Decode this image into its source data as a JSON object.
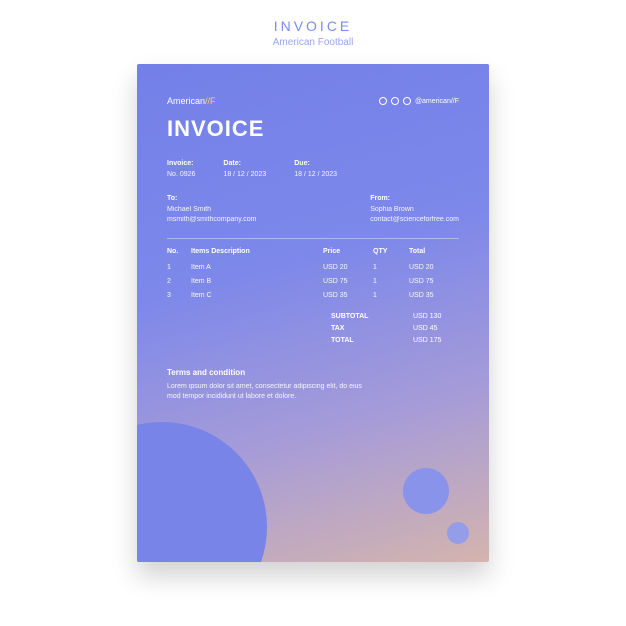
{
  "header": {
    "title": "INVOICE",
    "subtitle": "American Football"
  },
  "brand": {
    "name": "American",
    "accent": "//F"
  },
  "social": {
    "handle": "@american//F"
  },
  "bigTitle": "INVOICE",
  "meta": {
    "invoice": {
      "label": "Invoice:",
      "value": "No. 0926"
    },
    "date": {
      "label": "Date:",
      "value": "18 / 12 / 2023"
    },
    "due": {
      "label": "Due:",
      "value": "18 / 12 / 2023"
    }
  },
  "to": {
    "label": "To:",
    "name": "Michael Smith",
    "email": "msmith@smithcompany.com"
  },
  "from": {
    "label": "From:",
    "name": "Sophia Brown",
    "email": "contact@scienceforfree.com"
  },
  "columns": {
    "no": "No.",
    "desc": "Items Description",
    "price": "Price",
    "qty": "QTY",
    "total": "Total"
  },
  "items": [
    {
      "no": "1",
      "desc": "Item A",
      "price": "USD 20",
      "qty": "1",
      "total": "USD 20"
    },
    {
      "no": "2",
      "desc": "Item B",
      "price": "USD 75",
      "qty": "1",
      "total": "USD 75"
    },
    {
      "no": "3",
      "desc": "Item C",
      "price": "USD 35",
      "qty": "1",
      "total": "USD 35"
    }
  ],
  "totals": {
    "subtotal": {
      "label": "SUBTOTAL",
      "value": "USD 130"
    },
    "tax": {
      "label": "TAX",
      "value": "USD 45"
    },
    "total": {
      "label": "TOTAL",
      "value": "USD 175"
    }
  },
  "terms": {
    "title": "Terms and condition",
    "body": "Lorem ipsum dolor sit amet, consectetur adipiscing elit, do eius mod tempor incididunt ut labore et dolore."
  }
}
